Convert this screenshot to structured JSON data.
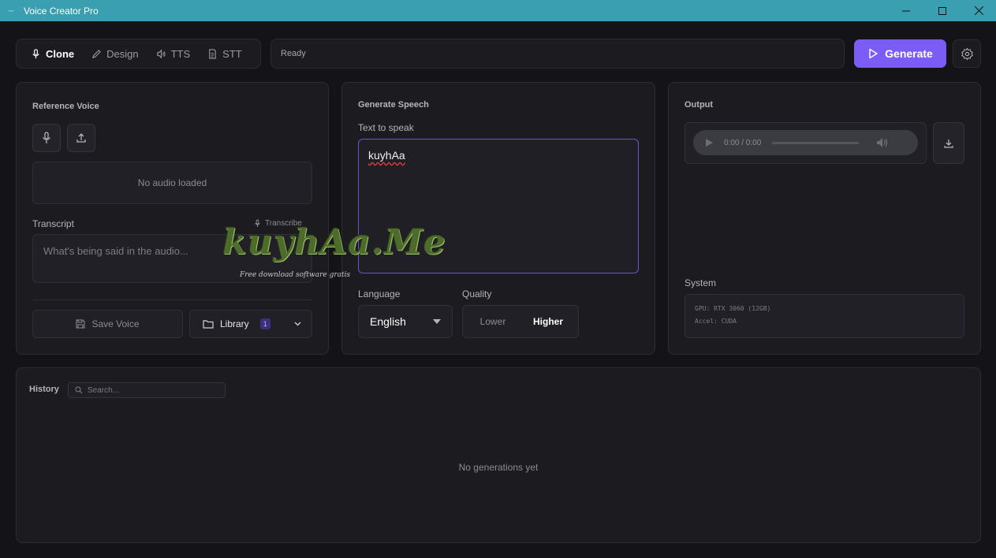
{
  "window": {
    "title": "Voice Creator Pro"
  },
  "tabs": [
    {
      "label": "Clone",
      "icon": "mic-icon"
    },
    {
      "label": "Design",
      "icon": "pencil-icon"
    },
    {
      "label": "TTS",
      "icon": "speaker-icon"
    },
    {
      "label": "STT",
      "icon": "document-icon"
    }
  ],
  "status": {
    "text": "Ready"
  },
  "generate_button": {
    "label": "Generate"
  },
  "reference_voice": {
    "title": "Reference Voice",
    "audio_placeholder": "No audio loaded",
    "transcript_label": "Transcript",
    "transcribe_label": "Transcribe",
    "transcript_placeholder": "What's being said in the audio...",
    "save_voice_label": "Save Voice",
    "library_label": "Library",
    "library_count": "1"
  },
  "generate_speech": {
    "title": "Generate Speech",
    "text_label": "Text to speak",
    "text_value": "kuyhAa",
    "language_label": "Language",
    "language_value": "English",
    "quality_label": "Quality",
    "quality_options": [
      "Lower",
      "Higher"
    ],
    "quality_selected": "Higher"
  },
  "output": {
    "title": "Output",
    "time": "0:00 / 0:00",
    "system_title": "System",
    "system_lines": [
      "GPU: RTX 3060 (12GB)",
      "Accel: CUDA"
    ]
  },
  "history": {
    "title": "History",
    "search_placeholder": "Search...",
    "empty_text": "No generations yet"
  },
  "watermark": {
    "main": "kuyhAa.Me",
    "sub": "Free download software gratis"
  },
  "colors": {
    "accent": "#7b5cf5",
    "titlebar": "#3a9fb0",
    "background": "#141418"
  }
}
